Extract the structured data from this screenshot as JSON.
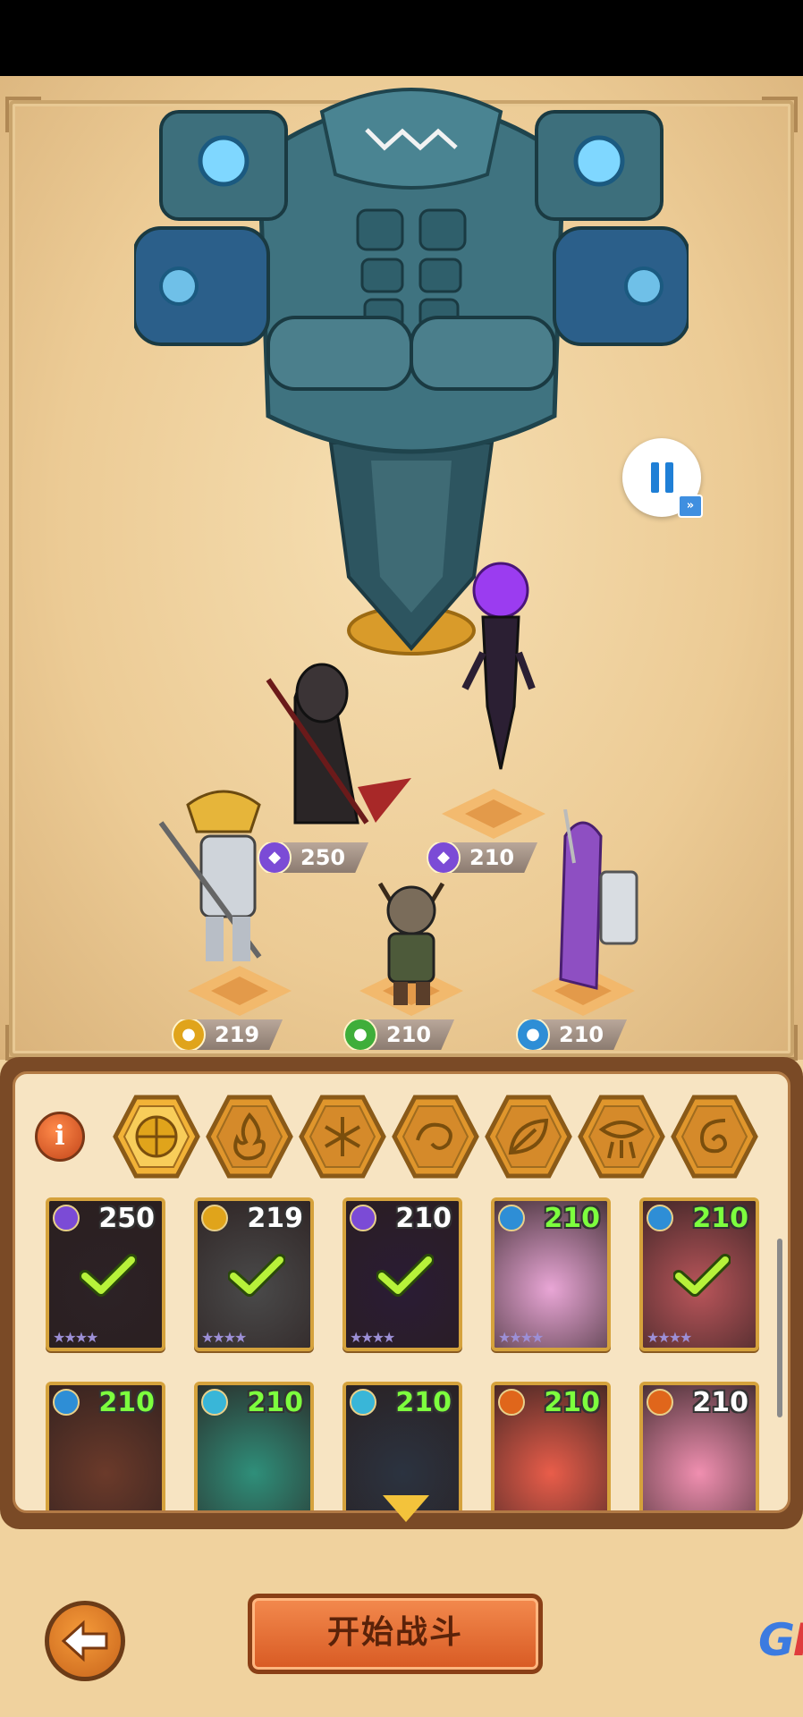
{
  "controls": {
    "pause_icon": "pause-icon",
    "speed_icon": "fast-forward-icon",
    "speed_glyph": "»"
  },
  "arena": {
    "heroes": [
      {
        "name": "hooded-reaper",
        "power": "250",
        "element": "dark",
        "element_color": "#7b4bd6"
      },
      {
        "name": "dark-sorceress",
        "power": "210",
        "element": "dark",
        "element_color": "#7b4bd6"
      },
      {
        "name": "mech-knight",
        "power": "219",
        "element": "light",
        "element_color": "#e0a41b"
      },
      {
        "name": "horned-warrior",
        "power": "210",
        "element": "nature",
        "element_color": "#3fae3a"
      },
      {
        "name": "purple-hair-maiden",
        "power": "210",
        "element": "water",
        "element_color": "#2e8ed6"
      }
    ]
  },
  "panel": {
    "info_label": "i",
    "filters": [
      {
        "id": "all",
        "icon": "all-elements-icon"
      },
      {
        "id": "fire",
        "icon": "fire-icon"
      },
      {
        "id": "ice",
        "icon": "snowflake-icon"
      },
      {
        "id": "water",
        "icon": "water-swirl-icon"
      },
      {
        "id": "nature",
        "icon": "leaf-icon"
      },
      {
        "id": "dark",
        "icon": "dark-eye-icon"
      },
      {
        "id": "light",
        "icon": "light-swirl-icon"
      }
    ],
    "cards": [
      {
        "power": "250",
        "element": "dark",
        "color": "#7b4bd6",
        "selected": true,
        "green": false,
        "stars": "★★★★",
        "bg": "#2c2226"
      },
      {
        "power": "219",
        "element": "light",
        "color": "#e0a41b",
        "selected": true,
        "green": false,
        "stars": "★★★★",
        "bg": "#4a4a4a"
      },
      {
        "power": "210",
        "element": "dark",
        "color": "#7b4bd6",
        "selected": true,
        "green": false,
        "stars": "★★★★",
        "bg": "#2a1c35"
      },
      {
        "power": "210",
        "element": "water",
        "color": "#2e8ed6",
        "selected": false,
        "green": true,
        "stars": "★★★★",
        "bg": "#e9a6d6"
      },
      {
        "power": "210",
        "element": "water",
        "color": "#2e8ed6",
        "selected": true,
        "green": true,
        "stars": "★★★★",
        "bg": "#b9555a"
      },
      {
        "power": "210",
        "element": "water",
        "color": "#2e8ed6",
        "selected": false,
        "green": true,
        "stars": "",
        "bg": "#6b3a2a"
      },
      {
        "power": "210",
        "element": "ice",
        "color": "#39b6d8",
        "selected": false,
        "green": true,
        "stars": "",
        "bg": "#2f8f7a"
      },
      {
        "power": "210",
        "element": "ice",
        "color": "#39b6d8",
        "selected": false,
        "green": true,
        "stars": "",
        "bg": "#2b3340"
      },
      {
        "power": "210",
        "element": "fire",
        "color": "#e0661b",
        "selected": false,
        "green": true,
        "stars": "",
        "bg": "#e95d4a"
      },
      {
        "power": "210",
        "element": "fire",
        "color": "#e0661b",
        "selected": false,
        "green": false,
        "stars": "",
        "bg": "#f08fb0"
      }
    ]
  },
  "footer": {
    "back_icon": "back-arrow-icon",
    "start_label": "开始战斗",
    "watermark_a": "G",
    "watermark_b": "K"
  }
}
